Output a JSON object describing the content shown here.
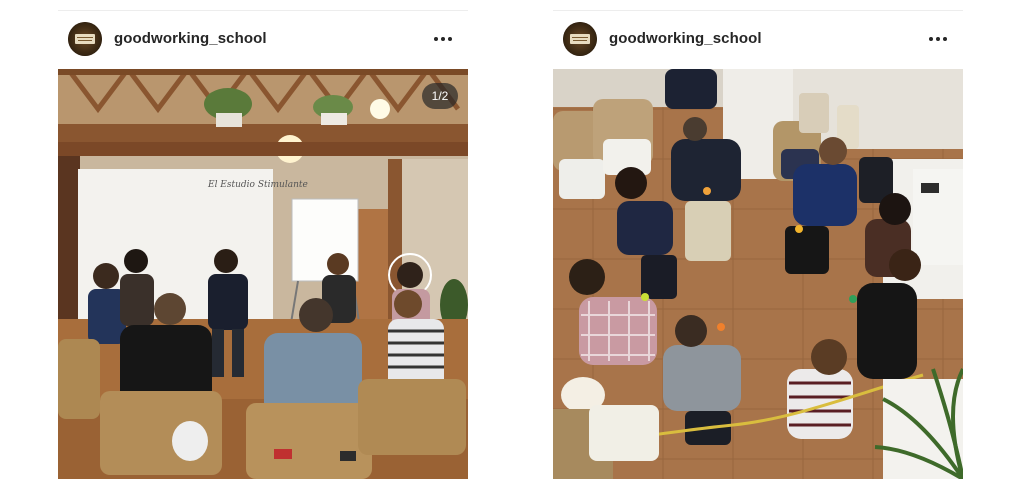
{
  "posts": [
    {
      "username": "goodworking_school",
      "counter": "1/2",
      "avatar_icon": "school-logo-avatar",
      "more_icon": "more-options-icon"
    },
    {
      "username": "goodworking_school",
      "avatar_icon": "school-logo-avatar",
      "more_icon": "more-options-icon"
    }
  ],
  "colors": {
    "username": "#262626",
    "counter_bg": "#262626",
    "divider": "#ededed"
  }
}
